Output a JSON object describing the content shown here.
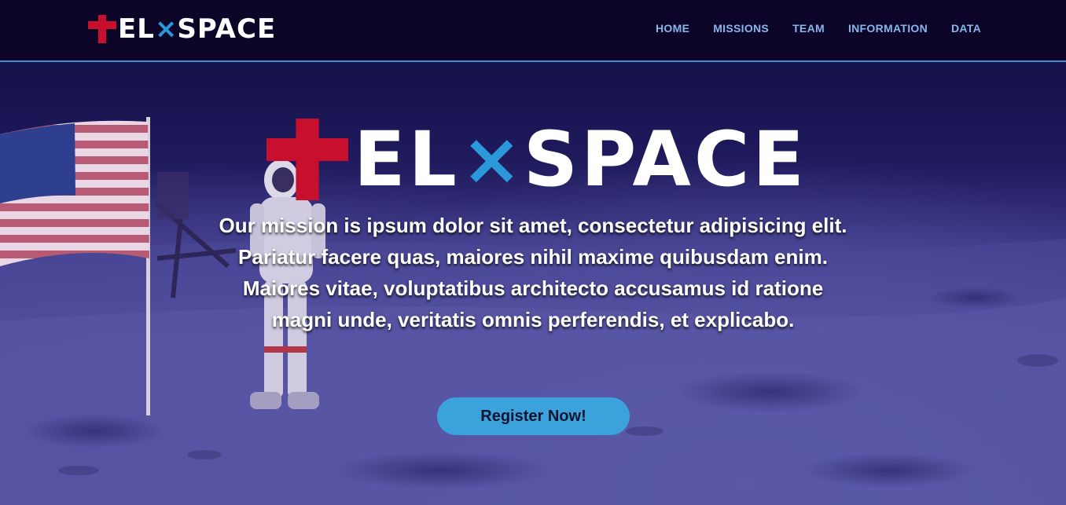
{
  "brand": {
    "part1": "EL",
    "x": "×",
    "part2": "SPACE",
    "colors": {
      "cross": "#c8102e",
      "x": "#2a98d9",
      "text": "#ffffff"
    }
  },
  "nav": {
    "items": [
      {
        "label": "HOME"
      },
      {
        "label": "MISSIONS"
      },
      {
        "label": "TEAM"
      },
      {
        "label": "INFORMATION"
      },
      {
        "label": "DATA"
      }
    ]
  },
  "hero": {
    "mission_text": "Our mission is ipsum dolor sit amet, consectetur adipisicing elit. Pariatur facere quas, maiores nihil maxime quibusdam enim. Maiores vitae, voluptatibus architecto accusamus id ratione magni unde, veritatis omnis perferendis, et explicabo.",
    "cta_label": "Register Now!",
    "background": "moon-landing-astronaut-flag-photo"
  },
  "colors": {
    "navbar_bg": "#0c0528",
    "nav_link": "#87b7ec",
    "nav_border": "#3d8fd6",
    "cta_bg": "#3ba2dc",
    "cta_text": "#0f1430"
  }
}
